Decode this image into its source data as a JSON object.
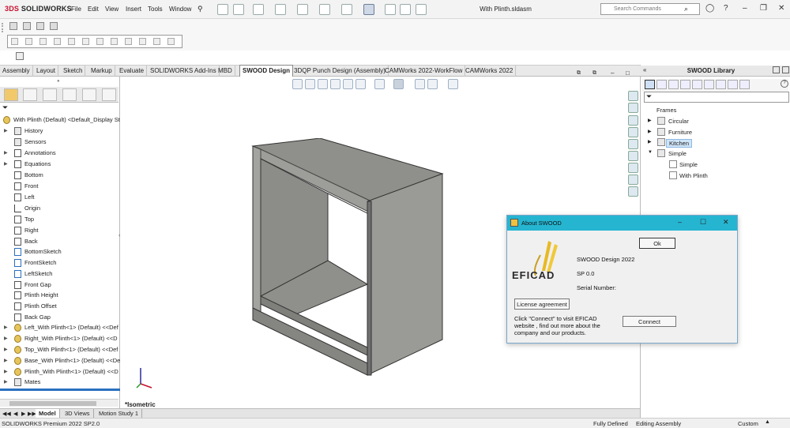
{
  "app": {
    "logo_prefix": "3DS",
    "logo": "SOLIDWORKS",
    "menu": [
      "File",
      "Edit",
      "View",
      "Insert",
      "Tools",
      "Window"
    ],
    "doc_title": "With Plinth.sldasm",
    "search_placeholder": "Search Commands"
  },
  "tabs": [
    "Assembly",
    "Layout",
    "Sketch",
    "Markup",
    "Evaluate",
    "SOLIDWORKS Add-Ins",
    "MBD",
    "SWOOD Design",
    "3DQP Punch Design (Assembly)",
    "CAMWorks 2022-WorkFlow",
    "CAMWorks 2022"
  ],
  "active_tab": "SWOOD Design",
  "tree": {
    "root": "With Plinth (Default) <Default_Display St",
    "items": [
      "History",
      "Sensors",
      "Annotations",
      "Equations",
      "Bottom",
      "Front",
      "Left",
      "Origin",
      "Top",
      "Right",
      "Back",
      "BottomSketch",
      "FrontSketch",
      "LeftSketch",
      "Front Gap",
      "Plinth Height",
      "Plinth Offset",
      "Back Gap",
      "Left_With Plinth<1> (Default) <<Def",
      "Right_With Plinth<1> (Default) <<D",
      "Top_With Plinth<1> (Default) <<Def",
      "Base_With Plinth<1> (Default) <<De",
      "Plinth_With Plinth<1> (Default) <<D",
      "Mates"
    ]
  },
  "viewport": {
    "view_label": "*Isometric"
  },
  "bottom_tabs": [
    "Model",
    "3D Views",
    "Motion Study 1"
  ],
  "status": {
    "product": "SOLIDWORKS Premium 2022 SP2.0",
    "state": "Fully Defined",
    "mode": "Editing Assembly",
    "units": "Custom"
  },
  "library": {
    "title": "SWOOD Library",
    "root": "Frames",
    "items": [
      "Circular",
      "Furniture",
      "Kitchen",
      "Simple"
    ],
    "children": [
      "Simple",
      "With Plinth"
    ]
  },
  "dialog": {
    "title": "About SWOOD",
    "ok": "Ok",
    "product": "SWOOD Design 2022",
    "sp": "SP 0.0",
    "serial": "Serial Number:",
    "license_btn": "License agreement",
    "connect_text_1": "Click \"Connect\" to visit EFICAD",
    "connect_text_2": "website , find out more about the",
    "connect_text_3": "company and our products.",
    "connect_btn": "Connect",
    "logo_text": "EFICAD"
  },
  "colors": {
    "accent": "#26b5d1",
    "model_face": "#8f8f8b",
    "brand": "#c8102e"
  }
}
